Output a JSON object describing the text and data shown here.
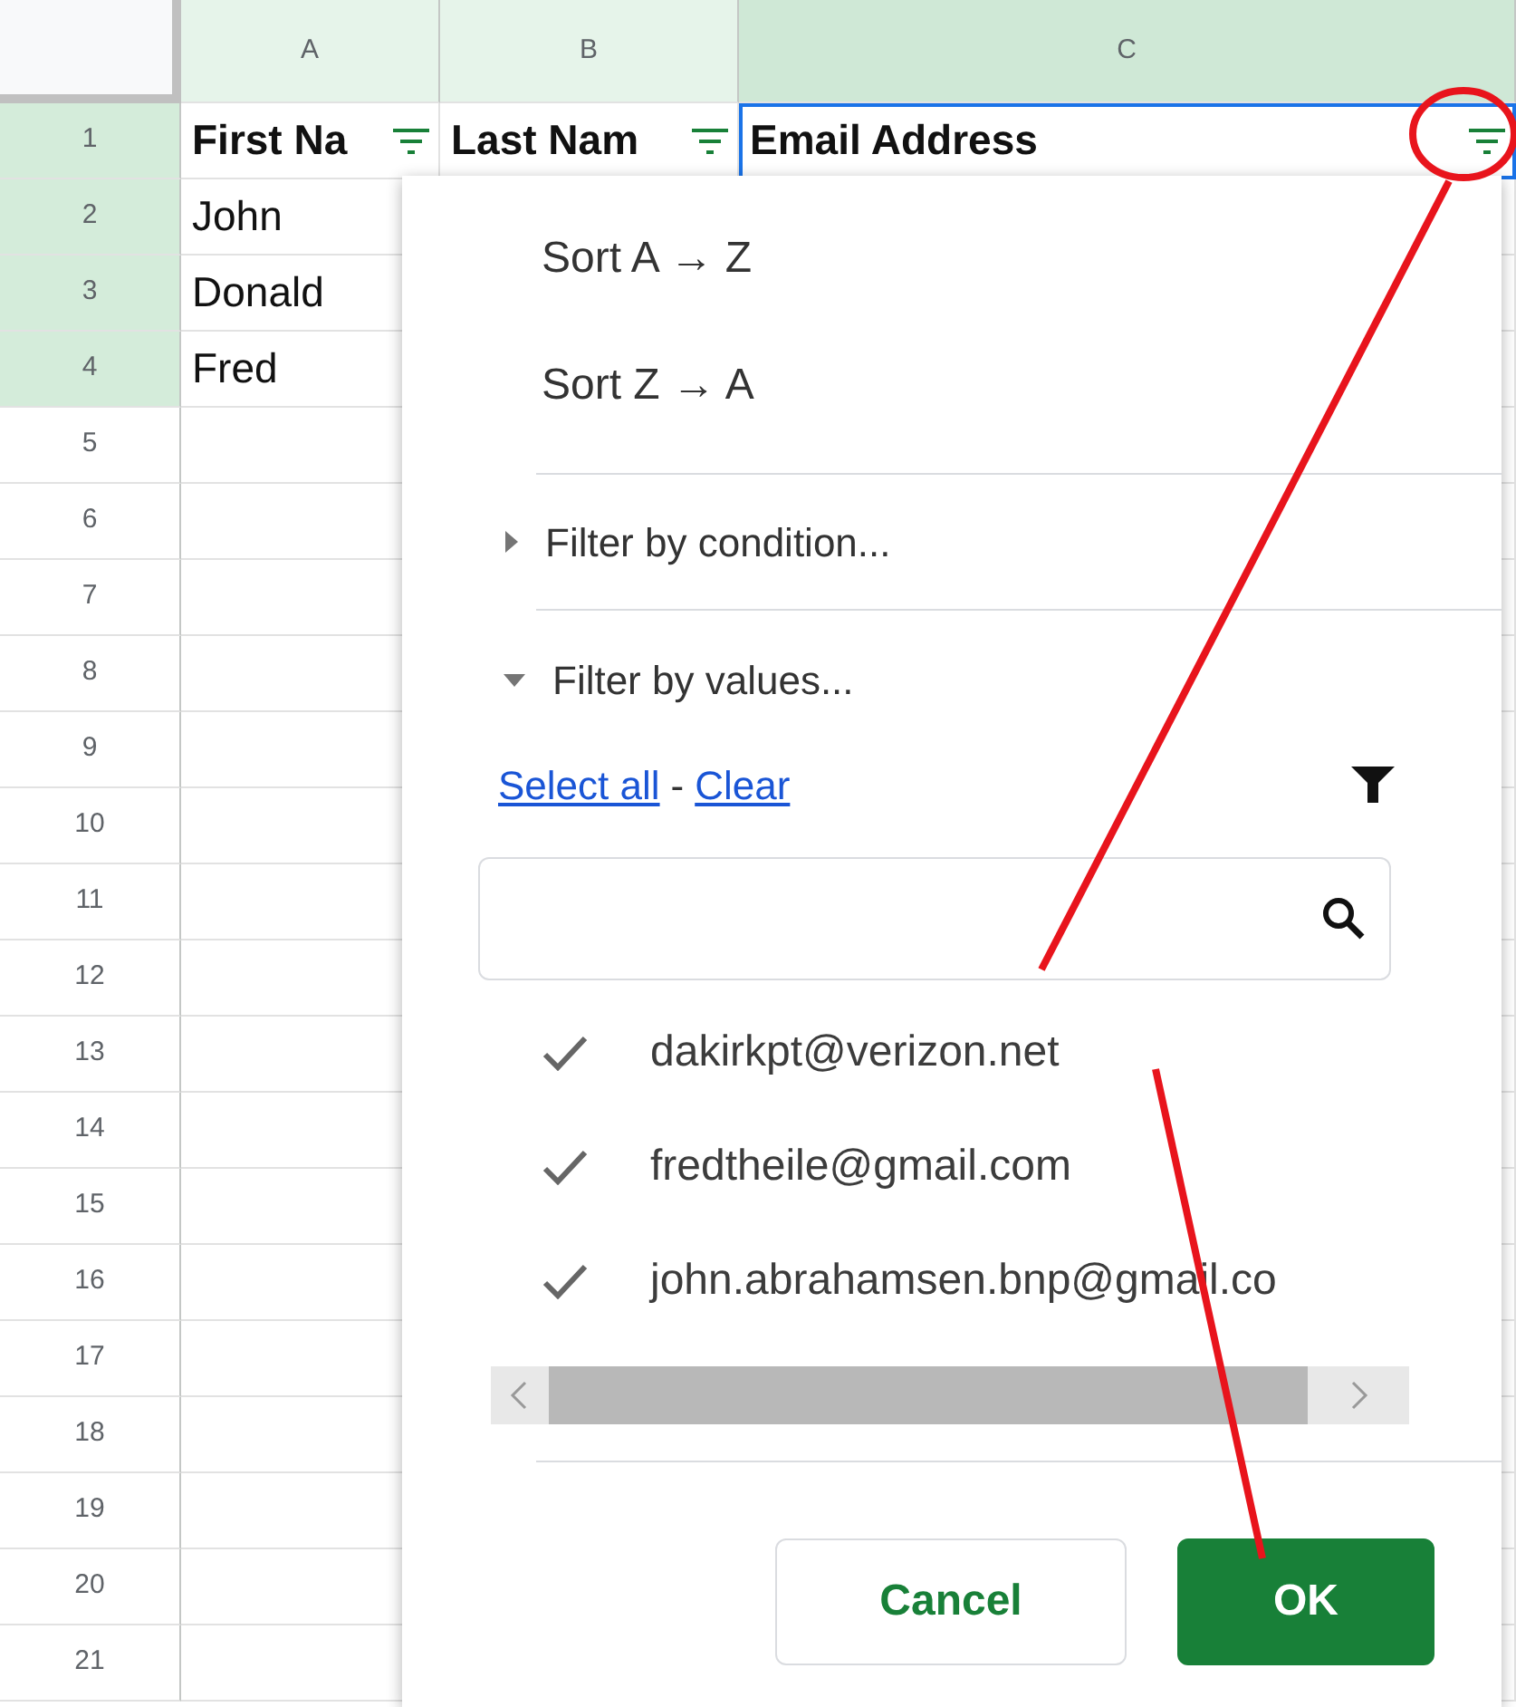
{
  "columns": [
    {
      "label": "A",
      "highlighted": true,
      "selected": false
    },
    {
      "label": "B",
      "highlighted": true,
      "selected": false
    },
    {
      "label": "C",
      "highlighted": true,
      "selected": true
    }
  ],
  "row_numbers": [
    {
      "label": "1",
      "highlighted": true
    },
    {
      "label": "2",
      "highlighted": true
    },
    {
      "label": "3",
      "highlighted": true
    },
    {
      "label": "4",
      "highlighted": true
    },
    {
      "label": "5",
      "highlighted": false
    },
    {
      "label": "6",
      "highlighted": false
    },
    {
      "label": "7",
      "highlighted": false
    },
    {
      "label": "8",
      "highlighted": false
    },
    {
      "label": "9",
      "highlighted": false
    },
    {
      "label": "10",
      "highlighted": false
    },
    {
      "label": "11",
      "highlighted": false
    },
    {
      "label": "12",
      "highlighted": false
    },
    {
      "label": "13",
      "highlighted": false
    },
    {
      "label": "14",
      "highlighted": false
    },
    {
      "label": "15",
      "highlighted": false
    },
    {
      "label": "16",
      "highlighted": false
    },
    {
      "label": "17",
      "highlighted": false
    },
    {
      "label": "18",
      "highlighted": false
    },
    {
      "label": "19",
      "highlighted": false
    },
    {
      "label": "20",
      "highlighted": false
    },
    {
      "label": "21",
      "highlighted": false
    }
  ],
  "header_cells": [
    {
      "text": "First Na",
      "selected": false
    },
    {
      "text": "Last Nam",
      "selected": false
    },
    {
      "text": "Email Address",
      "selected": true
    }
  ],
  "data_rows": [
    [
      "John"
    ],
    [
      "Donald"
    ],
    [
      "Fred"
    ]
  ],
  "filter_menu": {
    "sort_options": [
      "Sort A → Z",
      "Sort Z → A"
    ],
    "sections": [
      {
        "label": "Filter by condition...",
        "expanded": false
      },
      {
        "label": "Filter by values...",
        "expanded": true
      }
    ],
    "select_all": "Select all",
    "separator": "-",
    "clear": "Clear",
    "values": [
      {
        "text": "dakirkpt@verizon.net",
        "checked": true
      },
      {
        "text": "fredtheile@gmail.com",
        "checked": true
      },
      {
        "text": "john.abrahamsen.bnp@gmail.co",
        "checked": true
      }
    ],
    "buttons": [
      {
        "label": "Cancel",
        "kind": "secondary"
      },
      {
        "label": "OK",
        "kind": "primary"
      }
    ]
  }
}
